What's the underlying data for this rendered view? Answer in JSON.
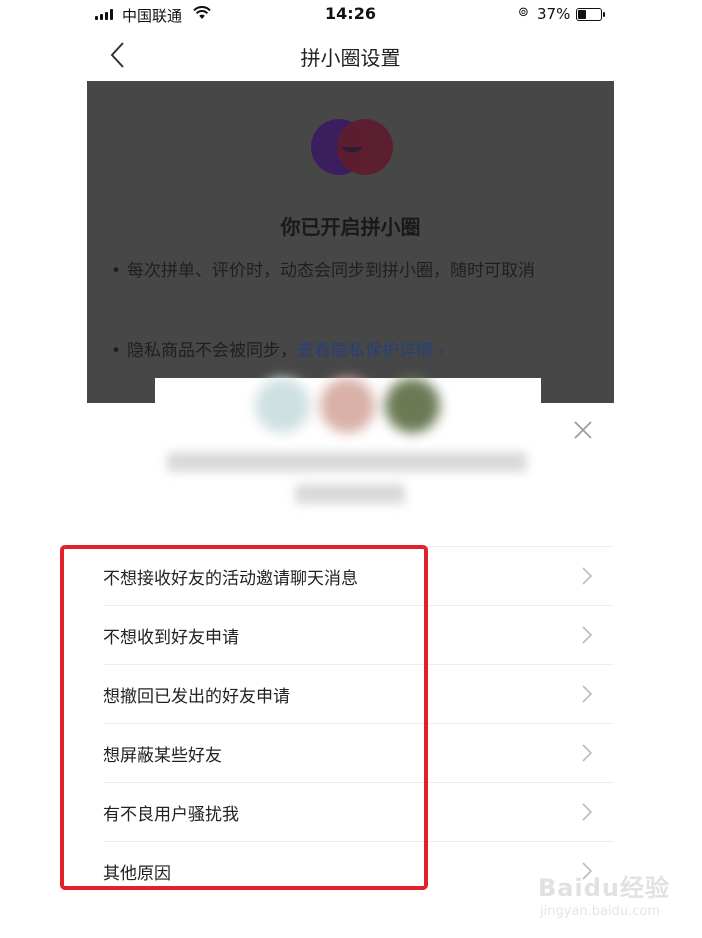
{
  "status_bar": {
    "carrier": "中国联通",
    "time": "14:26",
    "battery_percent": "37%",
    "battery_level": 0.37
  },
  "nav": {
    "title": "拼小圈设置"
  },
  "page": {
    "heading": "你已开启拼小圈",
    "bullet1": "每次拼单、评价时，动态会同步到拼小圈，随时可取消",
    "bullet2_text": "隐私商品不会被同步",
    "bullet2_link": "查看隐私保护详情 ›"
  },
  "sheet": {
    "options": [
      {
        "label": "不想接收好友的活动邀请聊天消息"
      },
      {
        "label": "不想收到好友申请"
      },
      {
        "label": "想撤回已发出的好友申请"
      },
      {
        "label": "想屏蔽某些好友"
      },
      {
        "label": "有不良用户骚扰我"
      },
      {
        "label": "其他原因"
      }
    ]
  },
  "watermark": {
    "text": "Baidu经验",
    "sub": "jingyan.baidu.com"
  },
  "colors": {
    "overlay": "#474747",
    "highlight": "#e0232a",
    "link": "#27407a"
  }
}
